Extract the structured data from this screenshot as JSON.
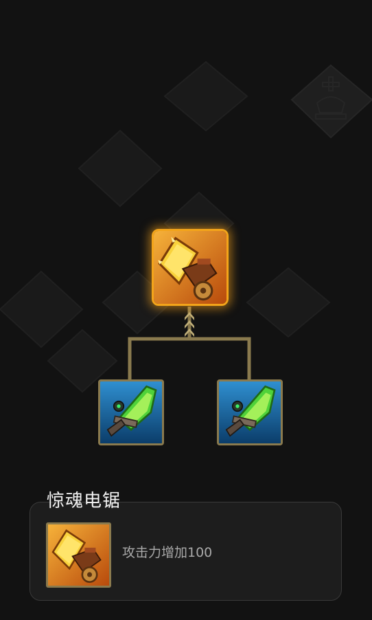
{
  "crafting_tree": {
    "result_item": {
      "icon": "chainsaw-icon"
    },
    "ingredients": [
      {
        "icon": "green-blade-icon"
      },
      {
        "icon": "green-blade-icon"
      }
    ]
  },
  "item_detail": {
    "name": "惊魂电锯",
    "icon": "chainsaw-icon",
    "description": "攻击力增加100"
  },
  "colors": {
    "background": "#121212",
    "result_border": "#f3a41a",
    "ingredient_border": "#8a7a4e",
    "connector": "#8a7a4e"
  }
}
